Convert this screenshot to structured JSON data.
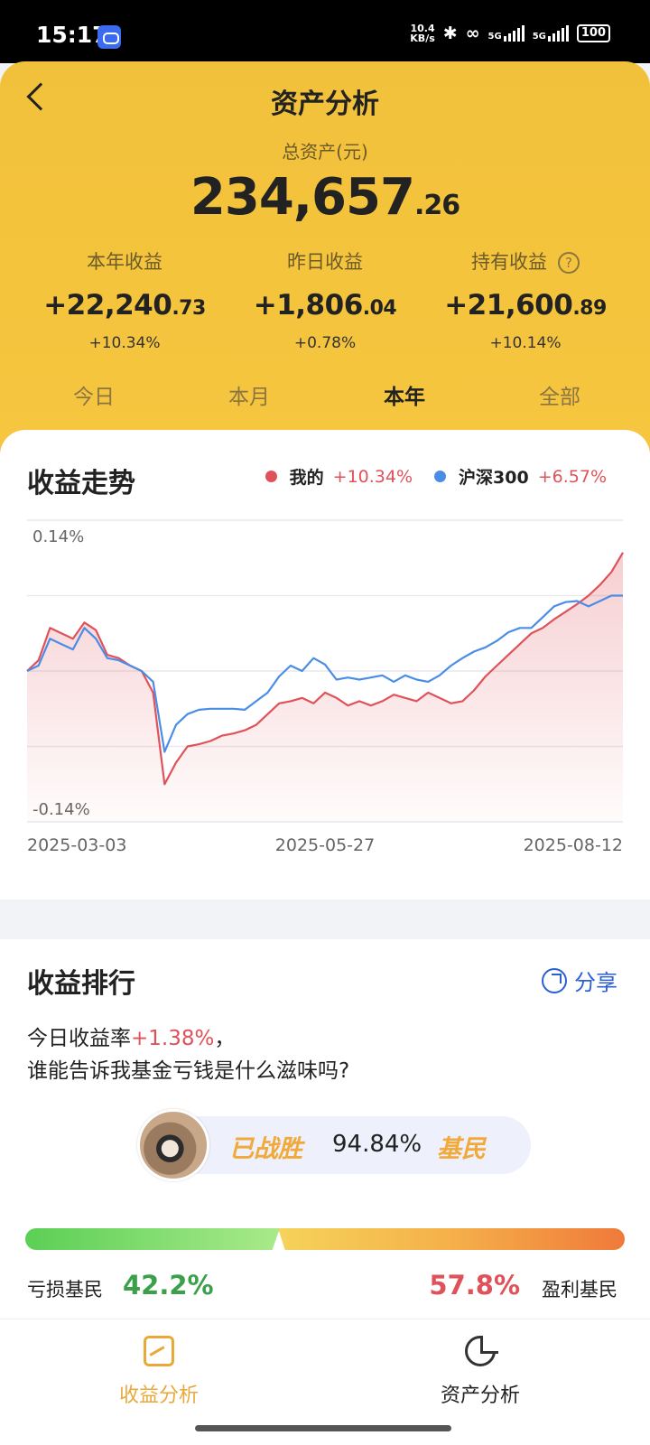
{
  "status": {
    "time": "15:17",
    "speed_value": "10.4",
    "speed_unit": "KB/s",
    "sim1": "5G",
    "sim2": "5G",
    "battery": "100"
  },
  "header": {
    "title": "资产分析",
    "total_label": "总资产(元)",
    "total_int": "234,657",
    "total_dec": ".26",
    "stats": [
      {
        "label": "本年收益",
        "int": "+22,240",
        "dec": ".73",
        "pct": "+10.34%"
      },
      {
        "label": "昨日收益",
        "int": "+1,806",
        "dec": ".04",
        "pct": "+0.78%"
      },
      {
        "label": "持有收益",
        "int": "+21,600",
        "dec": ".89",
        "pct": "+10.14%"
      }
    ],
    "help_glyph": "?",
    "tabs": [
      "今日",
      "本月",
      "本年",
      "全部"
    ],
    "active_tab": "本年"
  },
  "chart_card": {
    "title": "收益走势",
    "legend": [
      {
        "name": "我的",
        "value": "+10.34%",
        "color": "#e0525a"
      },
      {
        "name": "沪深300",
        "value": "+6.57%",
        "color": "#4a8de6"
      }
    ]
  },
  "chart_data": {
    "type": "line",
    "title": "收益走势",
    "y_top_label": "0.14%",
    "y_bottom_label": "-0.14%",
    "ylim": [
      -0.14,
      0.14
    ],
    "x_tick_labels": [
      "2025-03-03",
      "2025-05-27",
      "2025-08-12"
    ],
    "grid": true,
    "series": [
      {
        "name": "我的",
        "color": "#e0525a",
        "fill": true,
        "values": [
          0.0,
          0.01,
          0.04,
          0.035,
          0.03,
          0.045,
          0.038,
          0.015,
          0.012,
          0.005,
          0.0,
          -0.02,
          -0.105,
          -0.085,
          -0.07,
          -0.068,
          -0.065,
          -0.06,
          -0.058,
          -0.055,
          -0.05,
          -0.04,
          -0.03,
          -0.028,
          -0.025,
          -0.03,
          -0.02,
          -0.025,
          -0.032,
          -0.028,
          -0.032,
          -0.028,
          -0.022,
          -0.025,
          -0.028,
          -0.02,
          -0.025,
          -0.03,
          -0.028,
          -0.018,
          -0.005,
          0.005,
          0.015,
          0.025,
          0.035,
          0.04,
          0.048,
          0.055,
          0.062,
          0.07,
          0.08,
          0.092,
          0.11
        ],
        "note_unused": ""
      },
      {
        "name": "沪深300",
        "color": "#4a8de6",
        "fill": false,
        "values": [
          0.0,
          0.005,
          0.03,
          0.025,
          0.02,
          0.04,
          0.03,
          0.012,
          0.01,
          0.005,
          0.0,
          -0.01,
          -0.075,
          -0.05,
          -0.04,
          -0.036,
          -0.035,
          -0.035,
          -0.035,
          -0.036,
          -0.028,
          -0.02,
          -0.005,
          0.005,
          0.0,
          0.012,
          0.006,
          -0.008,
          -0.006,
          -0.008,
          -0.006,
          -0.004,
          -0.01,
          -0.004,
          -0.008,
          -0.01,
          -0.004,
          0.005,
          0.012,
          0.018,
          0.022,
          0.028,
          0.036,
          0.04,
          0.04,
          0.05,
          0.06,
          0.064,
          0.065,
          0.06,
          0.065,
          0.07,
          0.07
        ]
      }
    ]
  },
  "rank_card": {
    "title": "收益排行",
    "share": "分享",
    "line1_prefix": "今日收益率",
    "line1_rate": "+1.38%",
    "line1_suffix": "，",
    "line2": "谁能告诉我基金亏钱是什么滋味吗?",
    "beat_label": "已战胜",
    "beat_pct": "94.84%",
    "beat_suffix": "基民",
    "loss_label": "亏损基民",
    "loss_pct": "42.2%",
    "gain_pct": "57.8%",
    "gain_label": "盈利基民"
  },
  "bottom_nav": {
    "items": [
      {
        "label": "收益分析",
        "icon": "trend-chart-icon",
        "active": true
      },
      {
        "label": "资产分析",
        "icon": "pie-chart-icon",
        "active": false
      }
    ]
  }
}
